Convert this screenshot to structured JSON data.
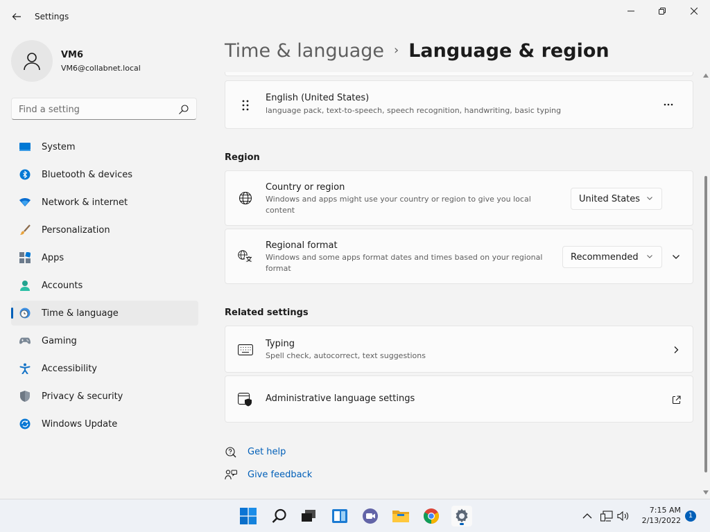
{
  "window": {
    "title": "Settings"
  },
  "profile": {
    "name": "VM6",
    "email": "VM6@collabnet.local"
  },
  "search": {
    "placeholder": "Find a setting"
  },
  "sidebar": {
    "items": [
      {
        "label": "System",
        "icon": "system-icon"
      },
      {
        "label": "Bluetooth & devices",
        "icon": "bluetooth-icon"
      },
      {
        "label": "Network & internet",
        "icon": "network-icon"
      },
      {
        "label": "Personalization",
        "icon": "brush-icon"
      },
      {
        "label": "Apps",
        "icon": "apps-icon"
      },
      {
        "label": "Accounts",
        "icon": "accounts-icon"
      },
      {
        "label": "Time & language",
        "icon": "clock-globe-icon",
        "active": true
      },
      {
        "label": "Gaming",
        "icon": "gamepad-icon"
      },
      {
        "label": "Accessibility",
        "icon": "accessibility-icon"
      },
      {
        "label": "Privacy & security",
        "icon": "shield-icon"
      },
      {
        "label": "Windows Update",
        "icon": "update-icon"
      }
    ]
  },
  "breadcrumb": {
    "parent": "Time & language",
    "separator": "›",
    "current": "Language & region"
  },
  "language_card": {
    "title": "English (United States)",
    "subtitle": "language pack, text-to-speech, speech recognition, handwriting, basic typing"
  },
  "region": {
    "heading": "Region",
    "country": {
      "title": "Country or region",
      "subtitle_line1": "Windows and apps might use your country or region to give you local",
      "subtitle_line2": "content",
      "value": "United States"
    },
    "format": {
      "title": "Regional format",
      "subtitle_line1": "Windows and some apps format dates and times based on your regional",
      "subtitle_line2": "format",
      "value": "Recommended"
    }
  },
  "related": {
    "heading": "Related settings",
    "typing": {
      "title": "Typing",
      "subtitle": "Spell check, autocorrect, text suggestions"
    },
    "admin": {
      "title": "Administrative language settings"
    }
  },
  "links": {
    "help": "Get help",
    "feedback": "Give feedback"
  },
  "taskbar": {
    "time": "7:15 AM",
    "date": "2/13/2022",
    "notifications": "1"
  },
  "colors": {
    "accent": "#005fb8",
    "background": "#f3f3f3",
    "card": "#fbfbfb"
  }
}
